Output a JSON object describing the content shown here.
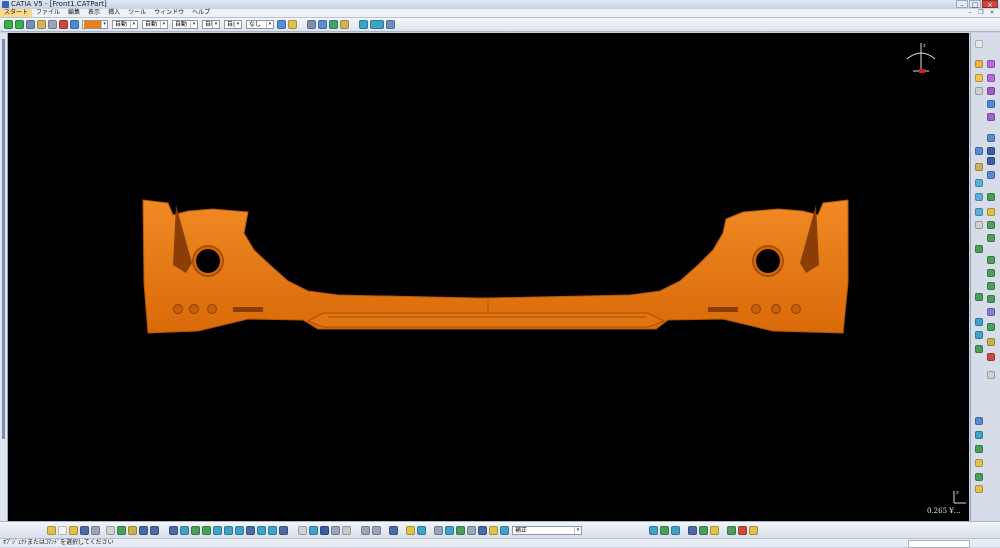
{
  "window": {
    "title": "CATIA V5 - [Front1.CATPart]",
    "buttons": {
      "minimize": "–",
      "maximize": "□",
      "close": "×"
    }
  },
  "menubar": {
    "items": [
      "スタート",
      "ファイル",
      "編集",
      "表示",
      "挿入",
      "ツール",
      "ウィンドウ",
      "ヘルプ"
    ],
    "mdi_buttons": {
      "minimize": "–",
      "restore": "❐",
      "close": "×"
    }
  },
  "toolbar_top": {
    "color_label": "",
    "combos": [
      {
        "label": "自動"
      },
      {
        "label": "自動"
      },
      {
        "label": "自動"
      },
      {
        "label": "自動"
      },
      {
        "label": "自由"
      },
      {
        "label": "なし"
      }
    ]
  },
  "toolbar_bottom": {
    "combo_label": "補正"
  },
  "viewport": {
    "background": "#000000",
    "model_color": "#ee7d14",
    "scale_label": "0.265 ¥..."
  },
  "statusbar": {
    "text": "ｵﾌﾞｼﾞｪｸﾄまたはｺﾏﾝﾄﾞを選択してください"
  },
  "colors": {
    "accent_orange": "#ee7d14",
    "chrome_bg": "#d6dde8",
    "close_red": "#c8493d"
  }
}
